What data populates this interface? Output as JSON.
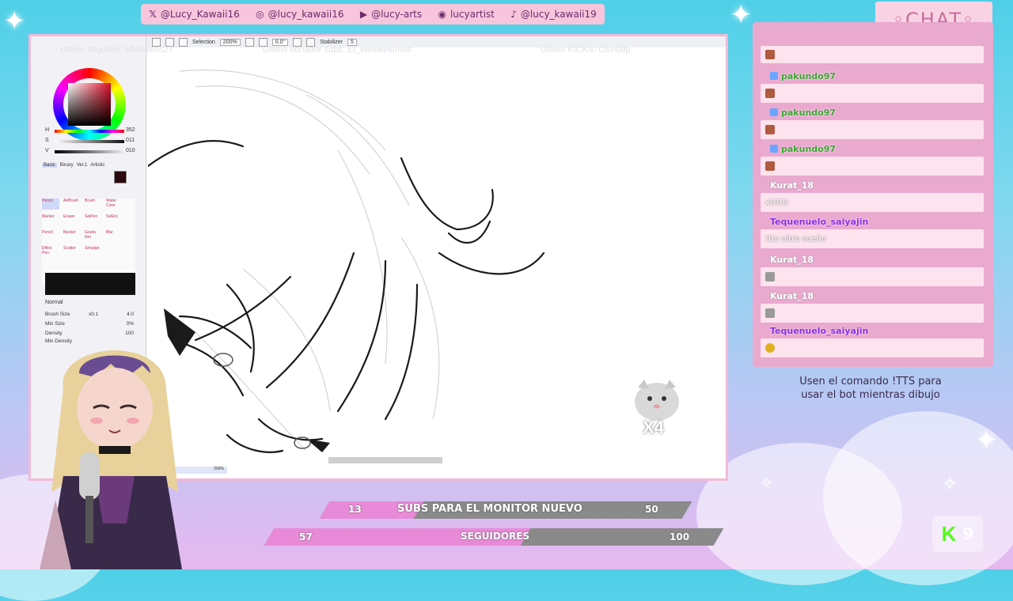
{
  "social": [
    {
      "icon": "x-icon",
      "glyph": "𝕏",
      "handle": "@Lucy_Kawaii16"
    },
    {
      "icon": "instagram-icon",
      "glyph": "◎",
      "handle": "@lucy_kawaii16"
    },
    {
      "icon": "youtube-icon",
      "glyph": "▶",
      "handle": "@lucy-arts"
    },
    {
      "icon": "discord-icon",
      "glyph": "◉",
      "handle": "lucyartist"
    },
    {
      "icon": "tiktok-icon",
      "glyph": "♪",
      "handle": "@lucy_kawaii19"
    }
  ],
  "overlay": {
    "last_follower": "Ultimo seguidor: Vbeluless27",
    "last_donor": "Ultimo donador subs: El_vendeHumos",
    "last_kicks": "Ultimo KICKS: Osv4ldp"
  },
  "app": {
    "toolbar": {
      "selection": "Selection",
      "zoom": "200%",
      "angle": "0.0°",
      "stabilizer": "Stabilizer",
      "stabilizer_value": "5"
    },
    "color": {
      "h_label": "H",
      "h_value": "352",
      "s_label": "S",
      "s_value": "011",
      "v_label": "V",
      "v_value": "010",
      "current": "#2a0810"
    },
    "tool_tabs": [
      "Basic",
      "Binary",
      "Ver.1",
      "Artistic"
    ],
    "tools": [
      "Pencil",
      "AirBrush",
      "Brush",
      "Water Color",
      "Marker",
      "Eraser",
      "SelPen",
      "SelErs",
      "Pencil",
      "Bucket",
      "Grada tion",
      "Blur",
      "Effect Pen",
      "Scatter",
      "Smudge",
      ""
    ],
    "blend_mode": "Normal",
    "brush_size_label": "Brush Size",
    "brush_size_mult": "x0.1",
    "brush_size_value": "4.0",
    "min_size_label": "Min Size",
    "min_size_value": "0%",
    "density_label": "Density",
    "density_value": "100",
    "min_density_label": "Min Density",
    "status_zoom": "200%"
  },
  "chat": {
    "title": "◦CHAT◦",
    "messages": [
      {
        "user": "",
        "badge": false,
        "style": "white",
        "text": "",
        "emote": "#b05a40"
      },
      {
        "user": "pakundo97",
        "badge": true,
        "style": "green",
        "text": "",
        "emote": "#b05a40"
      },
      {
        "user": "pakundo97",
        "badge": true,
        "style": "green",
        "text": "",
        "emote": "#b05a40"
      },
      {
        "user": "pakundo97",
        "badge": true,
        "style": "green",
        "text": "",
        "emote": "#b05a40"
      },
      {
        "user": "Kurat_18",
        "badge": false,
        "style": "white",
        "text": "xDDD",
        "emote": ""
      },
      {
        "user": "Tequenuelo_saiyajin",
        "badge": false,
        "style": "purple",
        "text": "!tts ultra sueño",
        "emote": ""
      },
      {
        "user": "Kurat_18",
        "badge": false,
        "style": "white",
        "text": "",
        "emote": "#9a9a9a"
      },
      {
        "user": "Kurat_18",
        "badge": false,
        "style": "white",
        "text": "",
        "emote": "#9a9a9a"
      },
      {
        "user": "Tequenuelo_saiyajin",
        "badge": false,
        "style": "purple",
        "text": "",
        "emote": "#e0b020"
      }
    ],
    "tts_note": "Usen el comando !TTS para usar el bot mientras dibujo"
  },
  "goals": {
    "subs": {
      "current": "13",
      "label": "SUBS PARA EL MONITOR NUEVO",
      "target": "50",
      "progress": 0.26
    },
    "followers": {
      "current": "57",
      "label": "SEGUIDORES",
      "target": "100",
      "progress": 0.57
    }
  },
  "cat_alert": {
    "multiplier": "X4"
  },
  "kick": {
    "count": "9"
  },
  "colors": {
    "accent_pink": "#f3b9d8",
    "chat_bg": "#eaa9cf",
    "goal_fill": "#e88ad8",
    "goal_track": "#8a8a8a"
  }
}
